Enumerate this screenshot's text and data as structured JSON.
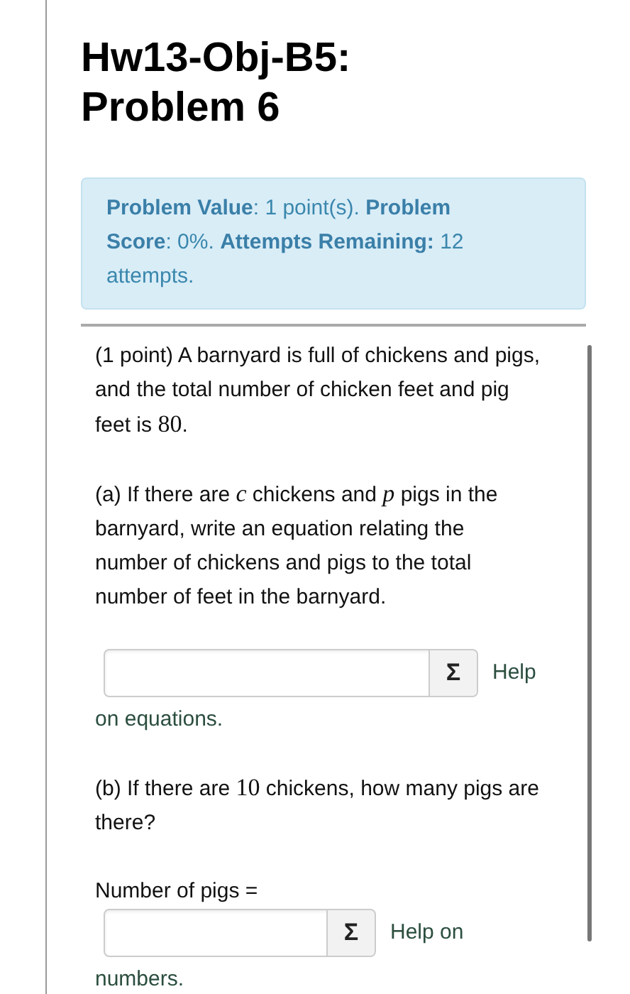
{
  "title": "Hw13-Obj-B5: Problem 6",
  "info": "**Problem Value**: 1 point(s). **Problem Score**: 0%. **Attempts Remaining:** 12 attempts.",
  "blocks": [
    {
      "kind": "paragraph",
      "parts": [
        {
          "kind": "text",
          "text": "(1 point) A barnyard is full of chickens and pigs, and the total number of chicken feet and pig feet is "
        },
        {
          "kind": "math",
          "text": "80"
        },
        {
          "kind": "text",
          "text": "."
        }
      ]
    },
    {
      "kind": "paragraph",
      "parts": [
        {
          "kind": "text",
          "text": "(a) If there are "
        },
        {
          "kind": "var",
          "text": "c"
        },
        {
          "kind": "text",
          "text": " chickens and "
        },
        {
          "kind": "var",
          "text": "p"
        },
        {
          "kind": "text",
          "text": " pigs in the barnyard, write an equation relating the number of chickens and pigs to the total number of feet in the barnyard."
        }
      ]
    },
    {
      "kind": "answer",
      "button": "Σ",
      "help": [
        "Help",
        "on equations."
      ]
    },
    {
      "kind": "paragraph",
      "parts": [
        {
          "kind": "text",
          "text": "(b) If there are "
        },
        {
          "kind": "math",
          "text": "10"
        },
        {
          "kind": "text",
          "text": " chickens, how many pigs are there?"
        }
      ]
    },
    {
      "kind": "label",
      "text": "Number of pigs ="
    },
    {
      "kind": "shortanswer",
      "button": "Σ",
      "help": [
        "Help on",
        "numbers."
      ]
    }
  ]
}
